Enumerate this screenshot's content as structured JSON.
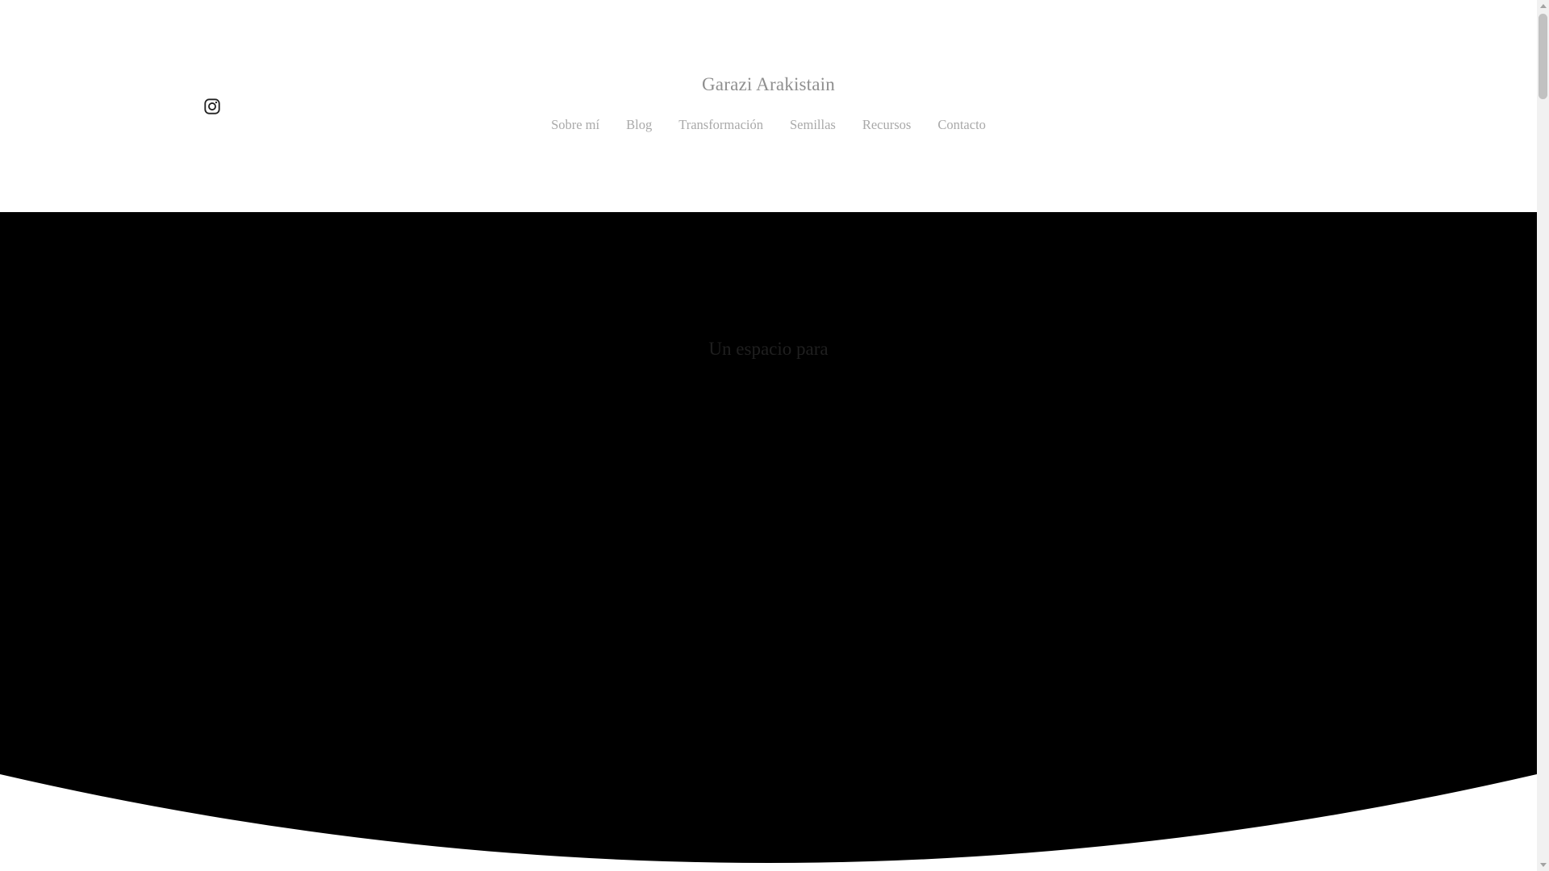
{
  "header": {
    "site_title": "Garazi Arakistain",
    "social_icon": "instagram-icon",
    "nav_items": [
      {
        "label": "Sobre mí"
      },
      {
        "label": "Blog"
      },
      {
        "label": "Transformación"
      },
      {
        "label": "Semillas"
      },
      {
        "label": "Recursos"
      },
      {
        "label": "Contacto"
      }
    ]
  },
  "hero": {
    "heading": "Un espacio para"
  },
  "colors": {
    "hero_background": "#000000",
    "page_background": "#ffffff",
    "title_text": "#8f8f8f",
    "nav_text": "#a9a9a9"
  },
  "scrollbar": {
    "thumb_position_fraction": 0
  }
}
